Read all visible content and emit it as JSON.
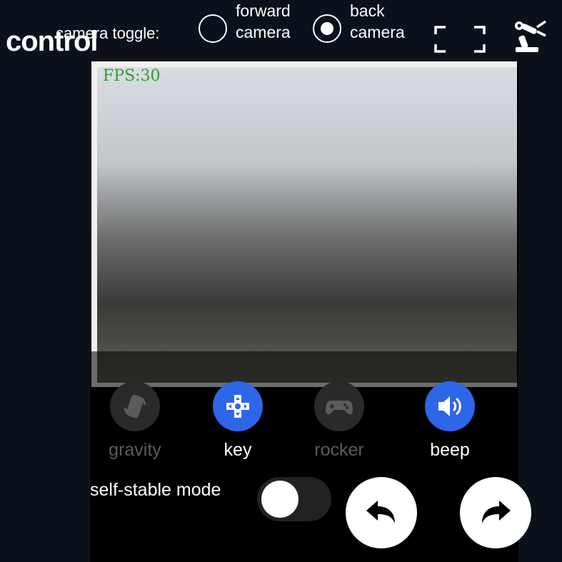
{
  "header": {
    "title": "control",
    "camera_toggle_label": "camera toggle:",
    "options": [
      {
        "line1": "forward",
        "line2": "camera",
        "selected": false
      },
      {
        "line1": "back",
        "line2": "camera",
        "selected": true
      }
    ],
    "icons": {
      "fullscreen": "fullscreen-icon",
      "robot": "robot-arm-icon"
    }
  },
  "video": {
    "fps_text": "FPS:30"
  },
  "modes": [
    {
      "label": "gravity",
      "active": false,
      "icon": "gravity-icon"
    },
    {
      "label": "key",
      "active": true,
      "icon": "dpad-icon"
    },
    {
      "label": "rocker",
      "active": false,
      "icon": "gamepad-icon"
    },
    {
      "label": "beep",
      "active": true,
      "icon": "speaker-icon"
    }
  ],
  "controls": {
    "self_stable_label": "self-stable mode",
    "self_stable_on": false,
    "rotate_left_icon": "rotate-left-icon",
    "rotate_right_icon": "rotate-right-icon"
  },
  "colors": {
    "accent": "#2e66e8",
    "background": "#0b111b",
    "inactive": "#5b5b5b",
    "fps_text": "#2f9e2f"
  }
}
